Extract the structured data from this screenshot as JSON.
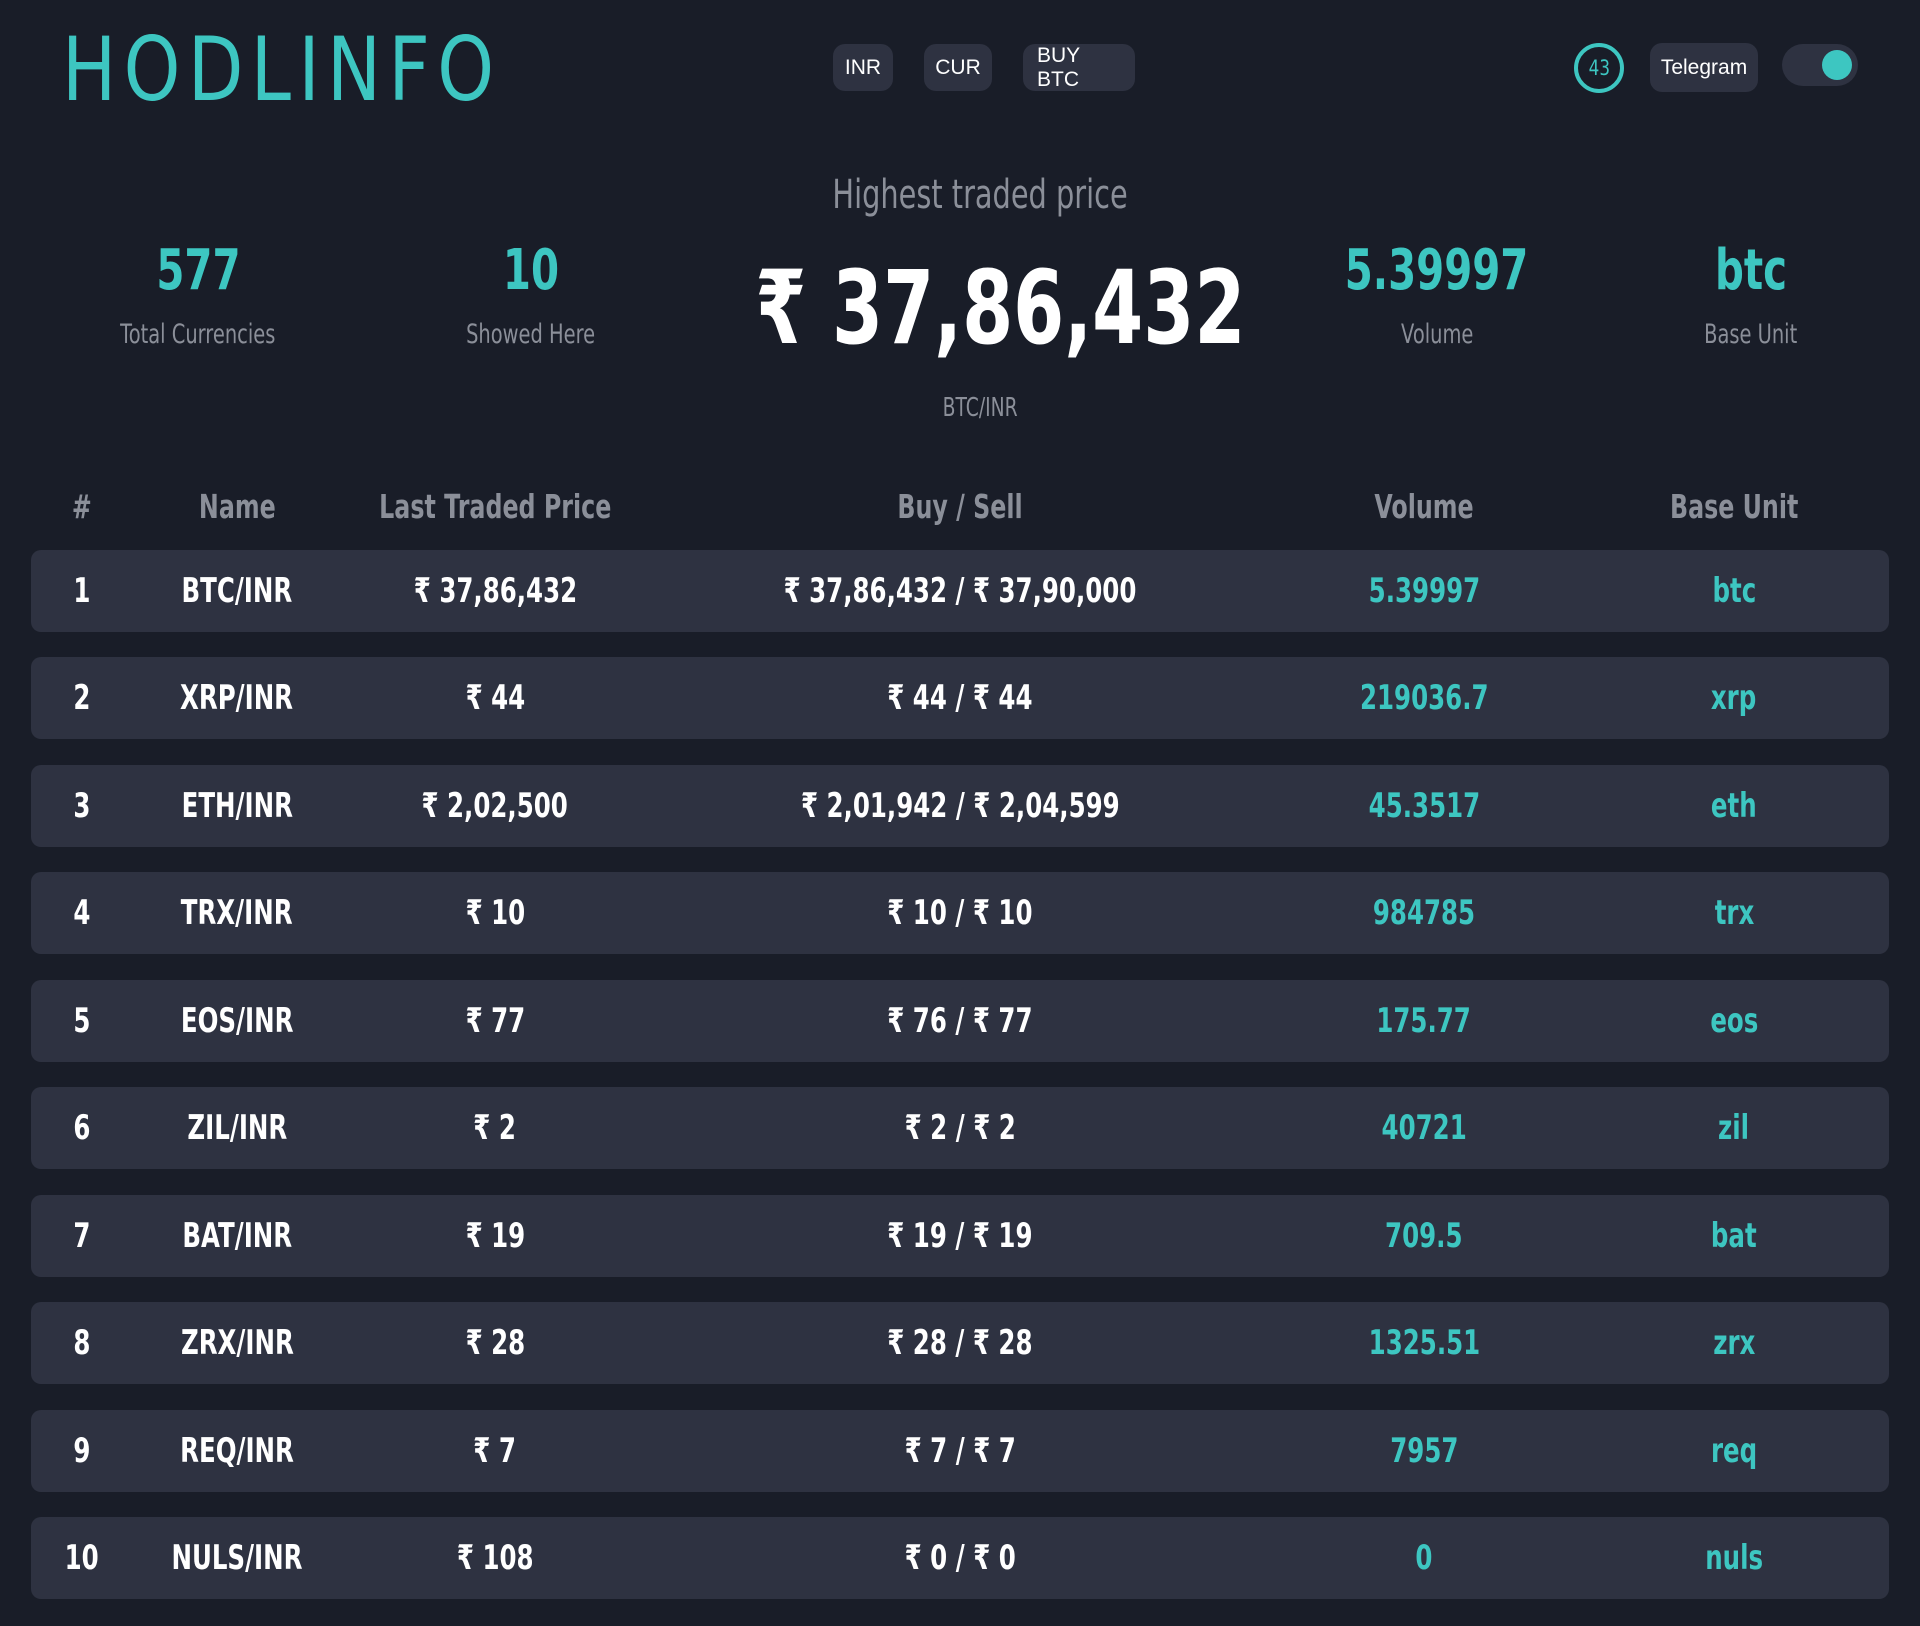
{
  "header": {
    "logo": "HODLINFO",
    "currency_button": "INR",
    "crypto_button": "CUR",
    "buy_button": "BUY BTC",
    "timer": "43",
    "telegram_button": "Telegram"
  },
  "stats": {
    "total_currencies": {
      "value": "577",
      "label": "Total Currencies"
    },
    "showed_here": {
      "value": "10",
      "label": "Showed Here"
    },
    "volume": {
      "value": "5.39997",
      "label": "Volume"
    },
    "base_unit": {
      "value": "btc",
      "label": "Base Unit"
    }
  },
  "hero": {
    "title": "Highest traded price",
    "price": "₹ 37,86,432",
    "pair": "BTC/INR"
  },
  "table": {
    "headers": [
      "#",
      "Name",
      "Last Traded Price",
      "Buy / Sell",
      "Volume",
      "Base Unit"
    ],
    "rows": [
      {
        "num": "1",
        "name": "BTC/INR",
        "last": "₹ 37,86,432",
        "buy_sell": "₹ 37,86,432 / ₹ 37,90,000",
        "volume": "5.39997",
        "base": "btc"
      },
      {
        "num": "2",
        "name": "XRP/INR",
        "last": "₹ 44",
        "buy_sell": "₹ 44 / ₹ 44",
        "volume": "219036.7",
        "base": "xrp"
      },
      {
        "num": "3",
        "name": "ETH/INR",
        "last": "₹ 2,02,500",
        "buy_sell": "₹ 2,01,942 / ₹ 2,04,599",
        "volume": "45.3517",
        "base": "eth"
      },
      {
        "num": "4",
        "name": "TRX/INR",
        "last": "₹ 10",
        "buy_sell": "₹ 10 / ₹ 10",
        "volume": "984785",
        "base": "trx"
      },
      {
        "num": "5",
        "name": "EOS/INR",
        "last": "₹ 77",
        "buy_sell": "₹ 76 / ₹ 77",
        "volume": "175.77",
        "base": "eos"
      },
      {
        "num": "6",
        "name": "ZIL/INR",
        "last": "₹ 2",
        "buy_sell": "₹ 2 / ₹ 2",
        "volume": "40721",
        "base": "zil"
      },
      {
        "num": "7",
        "name": "BAT/INR",
        "last": "₹ 19",
        "buy_sell": "₹ 19 / ₹ 19",
        "volume": "709.5",
        "base": "bat"
      },
      {
        "num": "8",
        "name": "ZRX/INR",
        "last": "₹ 28",
        "buy_sell": "₹ 28 / ₹ 28",
        "volume": "1325.51",
        "base": "zrx"
      },
      {
        "num": "9",
        "name": "REQ/INR",
        "last": "₹ 7",
        "buy_sell": "₹ 7 / ₹ 7",
        "volume": "7957",
        "base": "req"
      },
      {
        "num": "10",
        "name": "NULS/INR",
        "last": "₹ 108",
        "buy_sell": "₹ 0 / ₹ 0",
        "volume": "0",
        "base": "nuls"
      }
    ]
  },
  "colors": {
    "background": "#191d28",
    "card": "#2e3241",
    "accent": "#3dc6c1",
    "muted": "#8b8f99",
    "text": "#ffffff"
  },
  "icons": {
    "theme_toggle": "toggle-switch-icon"
  }
}
